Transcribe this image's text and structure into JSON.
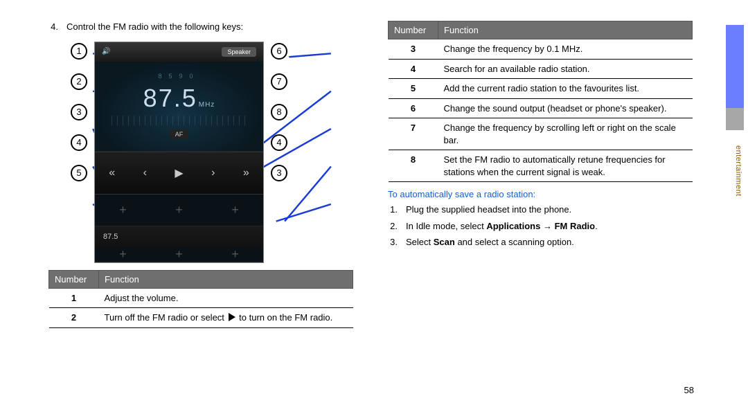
{
  "sideLabel": "entertainment",
  "pageNumber": "58",
  "left": {
    "step4_num": "4.",
    "step4_text": "Control the FM radio with the following keys:",
    "radio": {
      "speakerLabel": "Speaker",
      "scaleLeft": "85",
      "scaleRight": "90",
      "frequency": "87.5",
      "unit": "MHz",
      "af": "AF",
      "preset": "87.5"
    },
    "callouts_left": [
      "1",
      "2",
      "3",
      "4",
      "5"
    ],
    "callouts_right": [
      "6",
      "7",
      "8",
      "4",
      "3"
    ],
    "table": {
      "h1": "Number",
      "h2": "Function",
      "rows": [
        {
          "n": "1",
          "f": "Adjust the volume."
        },
        {
          "n": "2",
          "f": "Turn off the FM radio or select ▶ to turn on the FM radio."
        }
      ]
    }
  },
  "right": {
    "table": {
      "h1": "Number",
      "h2": "Function",
      "rows": [
        {
          "n": "3",
          "f": "Change the frequency by 0.1 MHz."
        },
        {
          "n": "4",
          "f": "Search for an available radio station."
        },
        {
          "n": "5",
          "f": "Add the current radio station to the favourites list."
        },
        {
          "n": "6",
          "f": "Change the sound output (headset or phone's speaker)."
        },
        {
          "n": "7",
          "f": "Change the frequency by scrolling left or right on the scale bar."
        },
        {
          "n": "8",
          "f": "Set the FM radio to automatically retune frequencies for stations when the current signal is weak."
        }
      ]
    },
    "subhead": "To automatically save a radio station:",
    "steps": [
      {
        "n": "1.",
        "t": "Plug the supplied headset into the phone."
      },
      {
        "n": "2.",
        "t_pre": "In Idle mode, select ",
        "t_bold": "Applications → FM Radio",
        "t_post": "."
      },
      {
        "n": "3.",
        "t_pre": "Select ",
        "t_bold": "Scan",
        "t_post": " and select a scanning option."
      }
    ]
  }
}
